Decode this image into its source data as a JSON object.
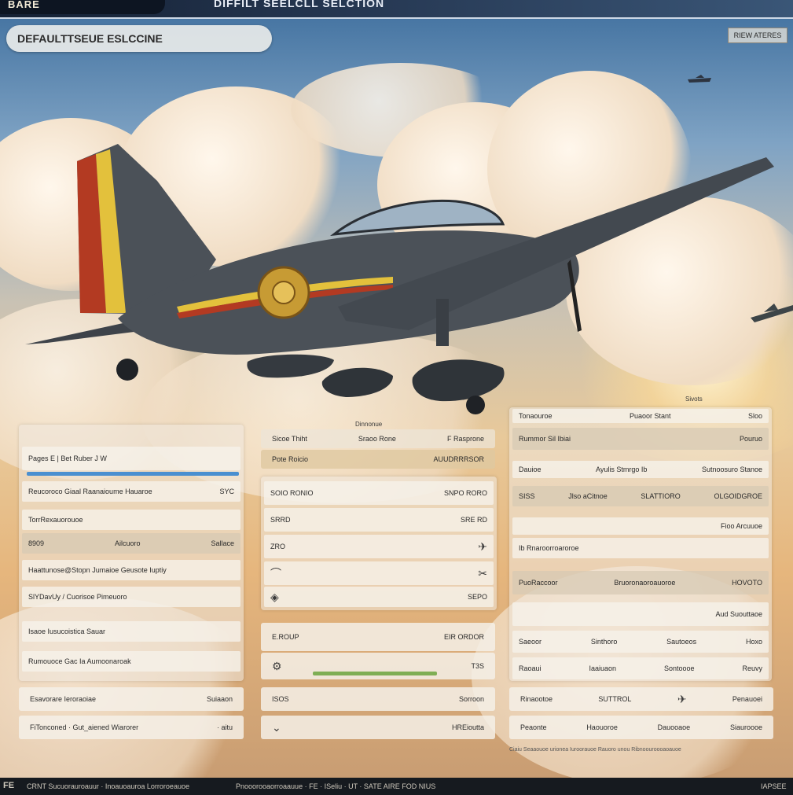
{
  "header": {
    "logo": "BARE",
    "title": "DIFFILT SEELCLL SELCTION",
    "top_right_button": "RIEW ATERES"
  },
  "filter": {
    "label": "DEFAULTTSEUE ESLCCINE"
  },
  "left_panel": {
    "title_row": "Pages E | Bet Ruber J W",
    "rows": [
      {
        "label": "Reucoroco Giaal Raanaioume Hauaroe",
        "value": "SYC"
      },
      {
        "label": "TorrRexauorouoe",
        "value": ""
      },
      {
        "label": "8909",
        "mid": "Ailcuoro",
        "value": "Sallace"
      },
      {
        "label": "Haattunose@Stopn Jumaioe Geusote Iuptiy",
        "value": ""
      },
      {
        "label": "SlYDavUy / Cuorisoe Pimeuoro",
        "value": ""
      },
      {
        "label": "Isaoe Iusucoistica Sauar",
        "value": ""
      },
      {
        "label": "Rumouoce Gac Ia Aumoonaroak",
        "value": ""
      }
    ],
    "footer_rows": [
      {
        "label": "Esavorare Ieroraoiae",
        "value": "Suiaaon"
      },
      {
        "label": "FiTonconed · Gut_aiened Wiarorer",
        "value": "· aitu"
      }
    ]
  },
  "mid_panel": {
    "caption": "Dinnonue",
    "header_row": {
      "a": "Sicoe Thiht",
      "b": "Sraoo Rone",
      "c": "F Rasprone"
    },
    "header_row2": {
      "a": "Pote Roicio",
      "b": "AUUDRRRSOR"
    },
    "grid_rows": [
      {
        "a": "SOIO RONIO",
        "b": "SNPO RORO"
      },
      {
        "a": "SRRD",
        "b": "SRE RD"
      },
      {
        "a": "ZRO",
        "b": ""
      },
      {
        "a": "",
        "b": "SEPO"
      }
    ],
    "stat_rows": [
      {
        "a": "E.ROUP",
        "b": "EIR ORDOR"
      },
      {
        "a": "",
        "b": "T3S"
      }
    ],
    "footer_rows": [
      {
        "a": "ISOS",
        "b": "Sorroon"
      },
      {
        "a": "",
        "b": "HREioutta"
      }
    ]
  },
  "right_panel": {
    "caption": "Sivots",
    "top_row": {
      "a": "Tonaouroe",
      "b": "Puaoor Stant",
      "c": "Sloo"
    },
    "row2": {
      "a": "Rummor Sil Ibiai",
      "b": "Pouruo"
    },
    "row3": {
      "a": "Dauioe",
      "b": "Ayulis Stmrgo Ib",
      "c": "Sutnoosuro Stanoe"
    },
    "row4": {
      "a": "SISS",
      "b": "Jlso aCitnoe",
      "c": "SLATTIORO",
      "d": "OLGOIDGROE"
    },
    "row5": {
      "a": "Fioo Arcuuoe"
    },
    "row6": {
      "a": "Ib Rnaroorroaroroe"
    },
    "row7": {
      "a": "PuoRaccoor",
      "b": "Bruoronaoroauoroe",
      "c": "HOVOTO"
    },
    "row8": {
      "a": "Aud Suouttaoe"
    },
    "row9": {
      "a": "Saeoor",
      "b": "Sinthoro",
      "c": "Sautoeos",
      "d": "Hoxo"
    },
    "row10": {
      "a": "Raoaui",
      "b": "Iaaiuaon",
      "c": "Sontoooe",
      "d": "Reuvy"
    },
    "footer_rows": [
      {
        "a": "Rinaootoe",
        "b": "SUTTROL",
        "c": "Penauoei"
      },
      {
        "a": "Peaonte",
        "b": "Haouoroe",
        "c": "Dauooaoe",
        "d": "Siauroooe"
      }
    ],
    "note": "Ciaiu Seaaouoe urionea Iuroorauoe Rauoro unou Ribnoouroooaoauoe"
  },
  "status_bar": {
    "left": "CRNT Sucuorauroauur · Inoauoauroa Lorroroeauoe",
    "center": "Pnooorooaorroaauue · FE · ISeliu · UT · SATE AIRE FOD NIUS",
    "right": "IAPSEE",
    "logo": "FE"
  },
  "colors": {
    "accent_blue": "#4a8fd0",
    "accent_green": "#7fae55",
    "plane_body": "#4b5158",
    "stripe_red": "#b33a22",
    "stripe_yellow": "#e3c13c"
  }
}
